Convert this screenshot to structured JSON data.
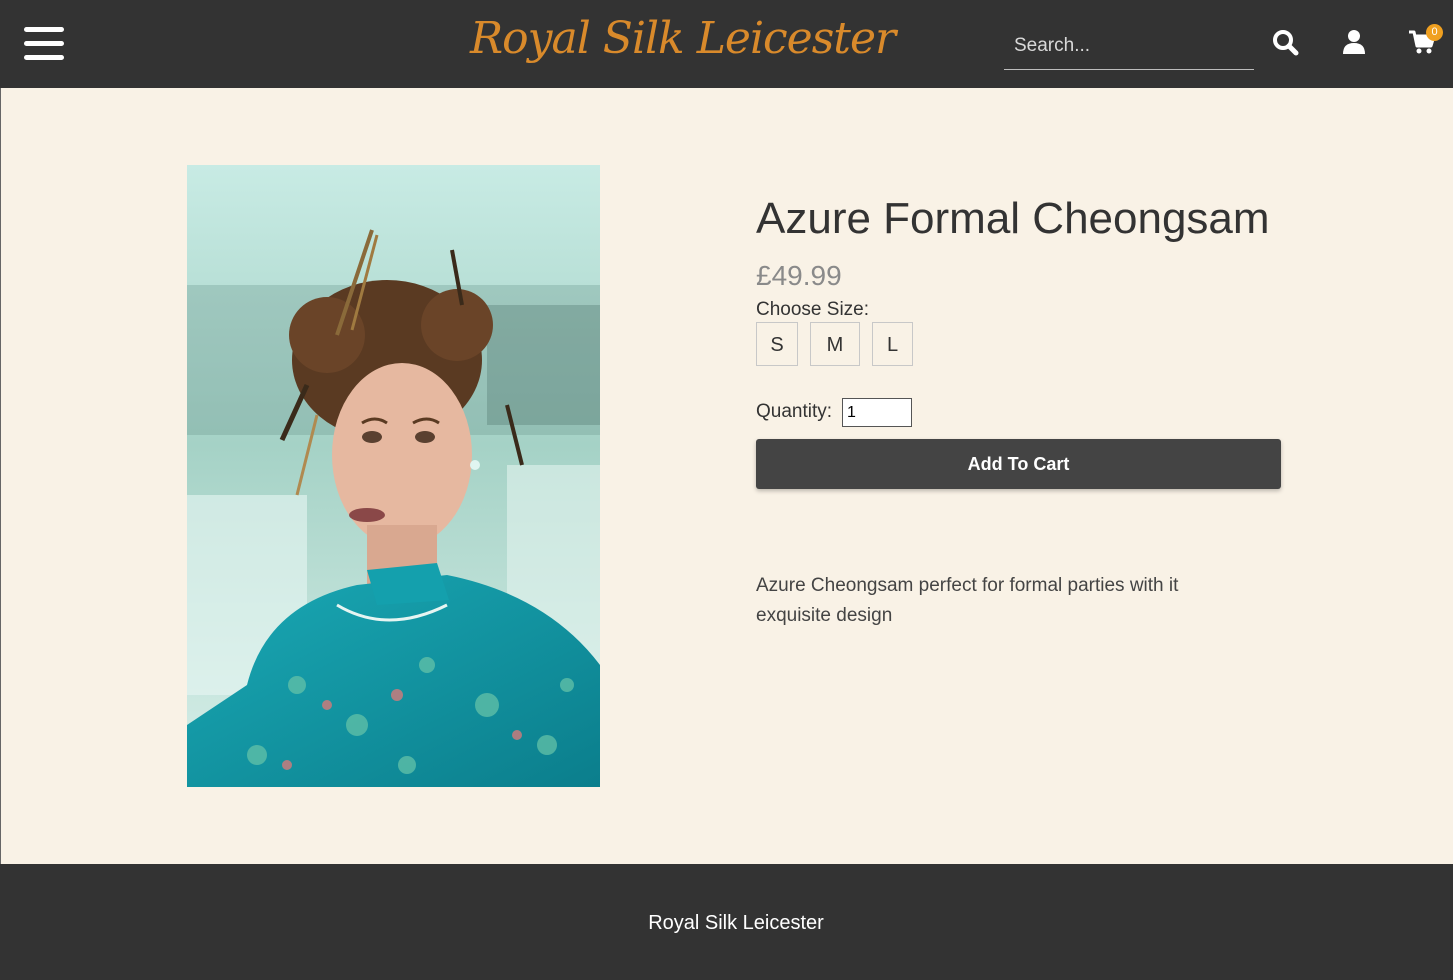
{
  "header": {
    "brand": "Royal Silk Leicester",
    "search": {
      "placeholder": "Search...",
      "value": ""
    },
    "cart_count": "0",
    "icons": [
      "menu-icon",
      "search-icon",
      "user-icon",
      "cart-icon"
    ]
  },
  "product": {
    "title": "Azure Formal Cheongsam",
    "price": "£49.99",
    "size_label": "Choose Size:",
    "sizes": [
      "S",
      "M",
      "L"
    ],
    "quantity_label": "Quantity:",
    "quantity_value": "1",
    "add_to_cart_label": "Add To Cart",
    "description": "Azure Cheongsam perfect for formal parties with it exquisite design",
    "image_alt": "Woman wearing teal brocade cheongsam"
  },
  "footer": {
    "text": "Royal Silk Leicester"
  },
  "colors": {
    "header_bg": "#333333",
    "brand": "#d98a2b",
    "page_bg": "#f9f2e6",
    "button_bg": "#444444",
    "badge": "#f0a020"
  }
}
